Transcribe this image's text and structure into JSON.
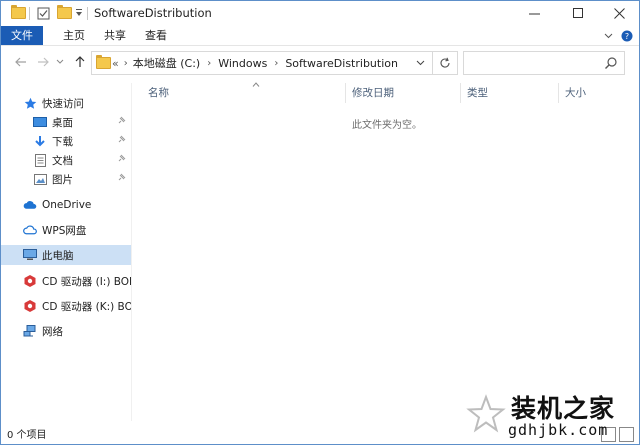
{
  "window": {
    "title": "SoftwareDistribution"
  },
  "ribbon": {
    "tabs": [
      {
        "label": "文件"
      },
      {
        "label": "主页"
      },
      {
        "label": "共享"
      },
      {
        "label": "查看"
      }
    ]
  },
  "address": {
    "overflow": "«",
    "crumbs": [
      "本地磁盘 (C:)",
      "Windows",
      "SoftwareDistribution"
    ]
  },
  "search": {
    "placeholder": ""
  },
  "sidebar": {
    "items": [
      {
        "label": "快速访问",
        "icon": "star-icon"
      },
      {
        "label": "桌面",
        "icon": "desktop-icon",
        "pinned": true
      },
      {
        "label": "下载",
        "icon": "download-icon",
        "pinned": true
      },
      {
        "label": "文档",
        "icon": "document-icon",
        "pinned": true
      },
      {
        "label": "图片",
        "icon": "picture-icon",
        "pinned": true
      },
      {
        "label": "OneDrive",
        "icon": "cloud-icon"
      },
      {
        "label": "WPS网盘",
        "icon": "cloud-icon"
      },
      {
        "label": "此电脑",
        "icon": "computer-icon",
        "selected": true
      },
      {
        "label": "CD 驱动器 (I:) BONJ",
        "icon": "cd-drive-icon"
      },
      {
        "label": "CD 驱动器 (K:) BON",
        "icon": "cd-drive-icon"
      },
      {
        "label": "网络",
        "icon": "network-icon"
      }
    ]
  },
  "columns": {
    "name": "名称",
    "modified": "修改日期",
    "type": "类型",
    "size": "大小"
  },
  "content": {
    "empty_message": "此文件夹为空。"
  },
  "status": {
    "item_count": "0 个项目"
  },
  "watermark": {
    "title": "装机之家",
    "url": "gdhjbk.com"
  },
  "colors": {
    "accent": "#1b5cb5",
    "selected": "#cce0f5",
    "folder": "#f4c84c"
  }
}
